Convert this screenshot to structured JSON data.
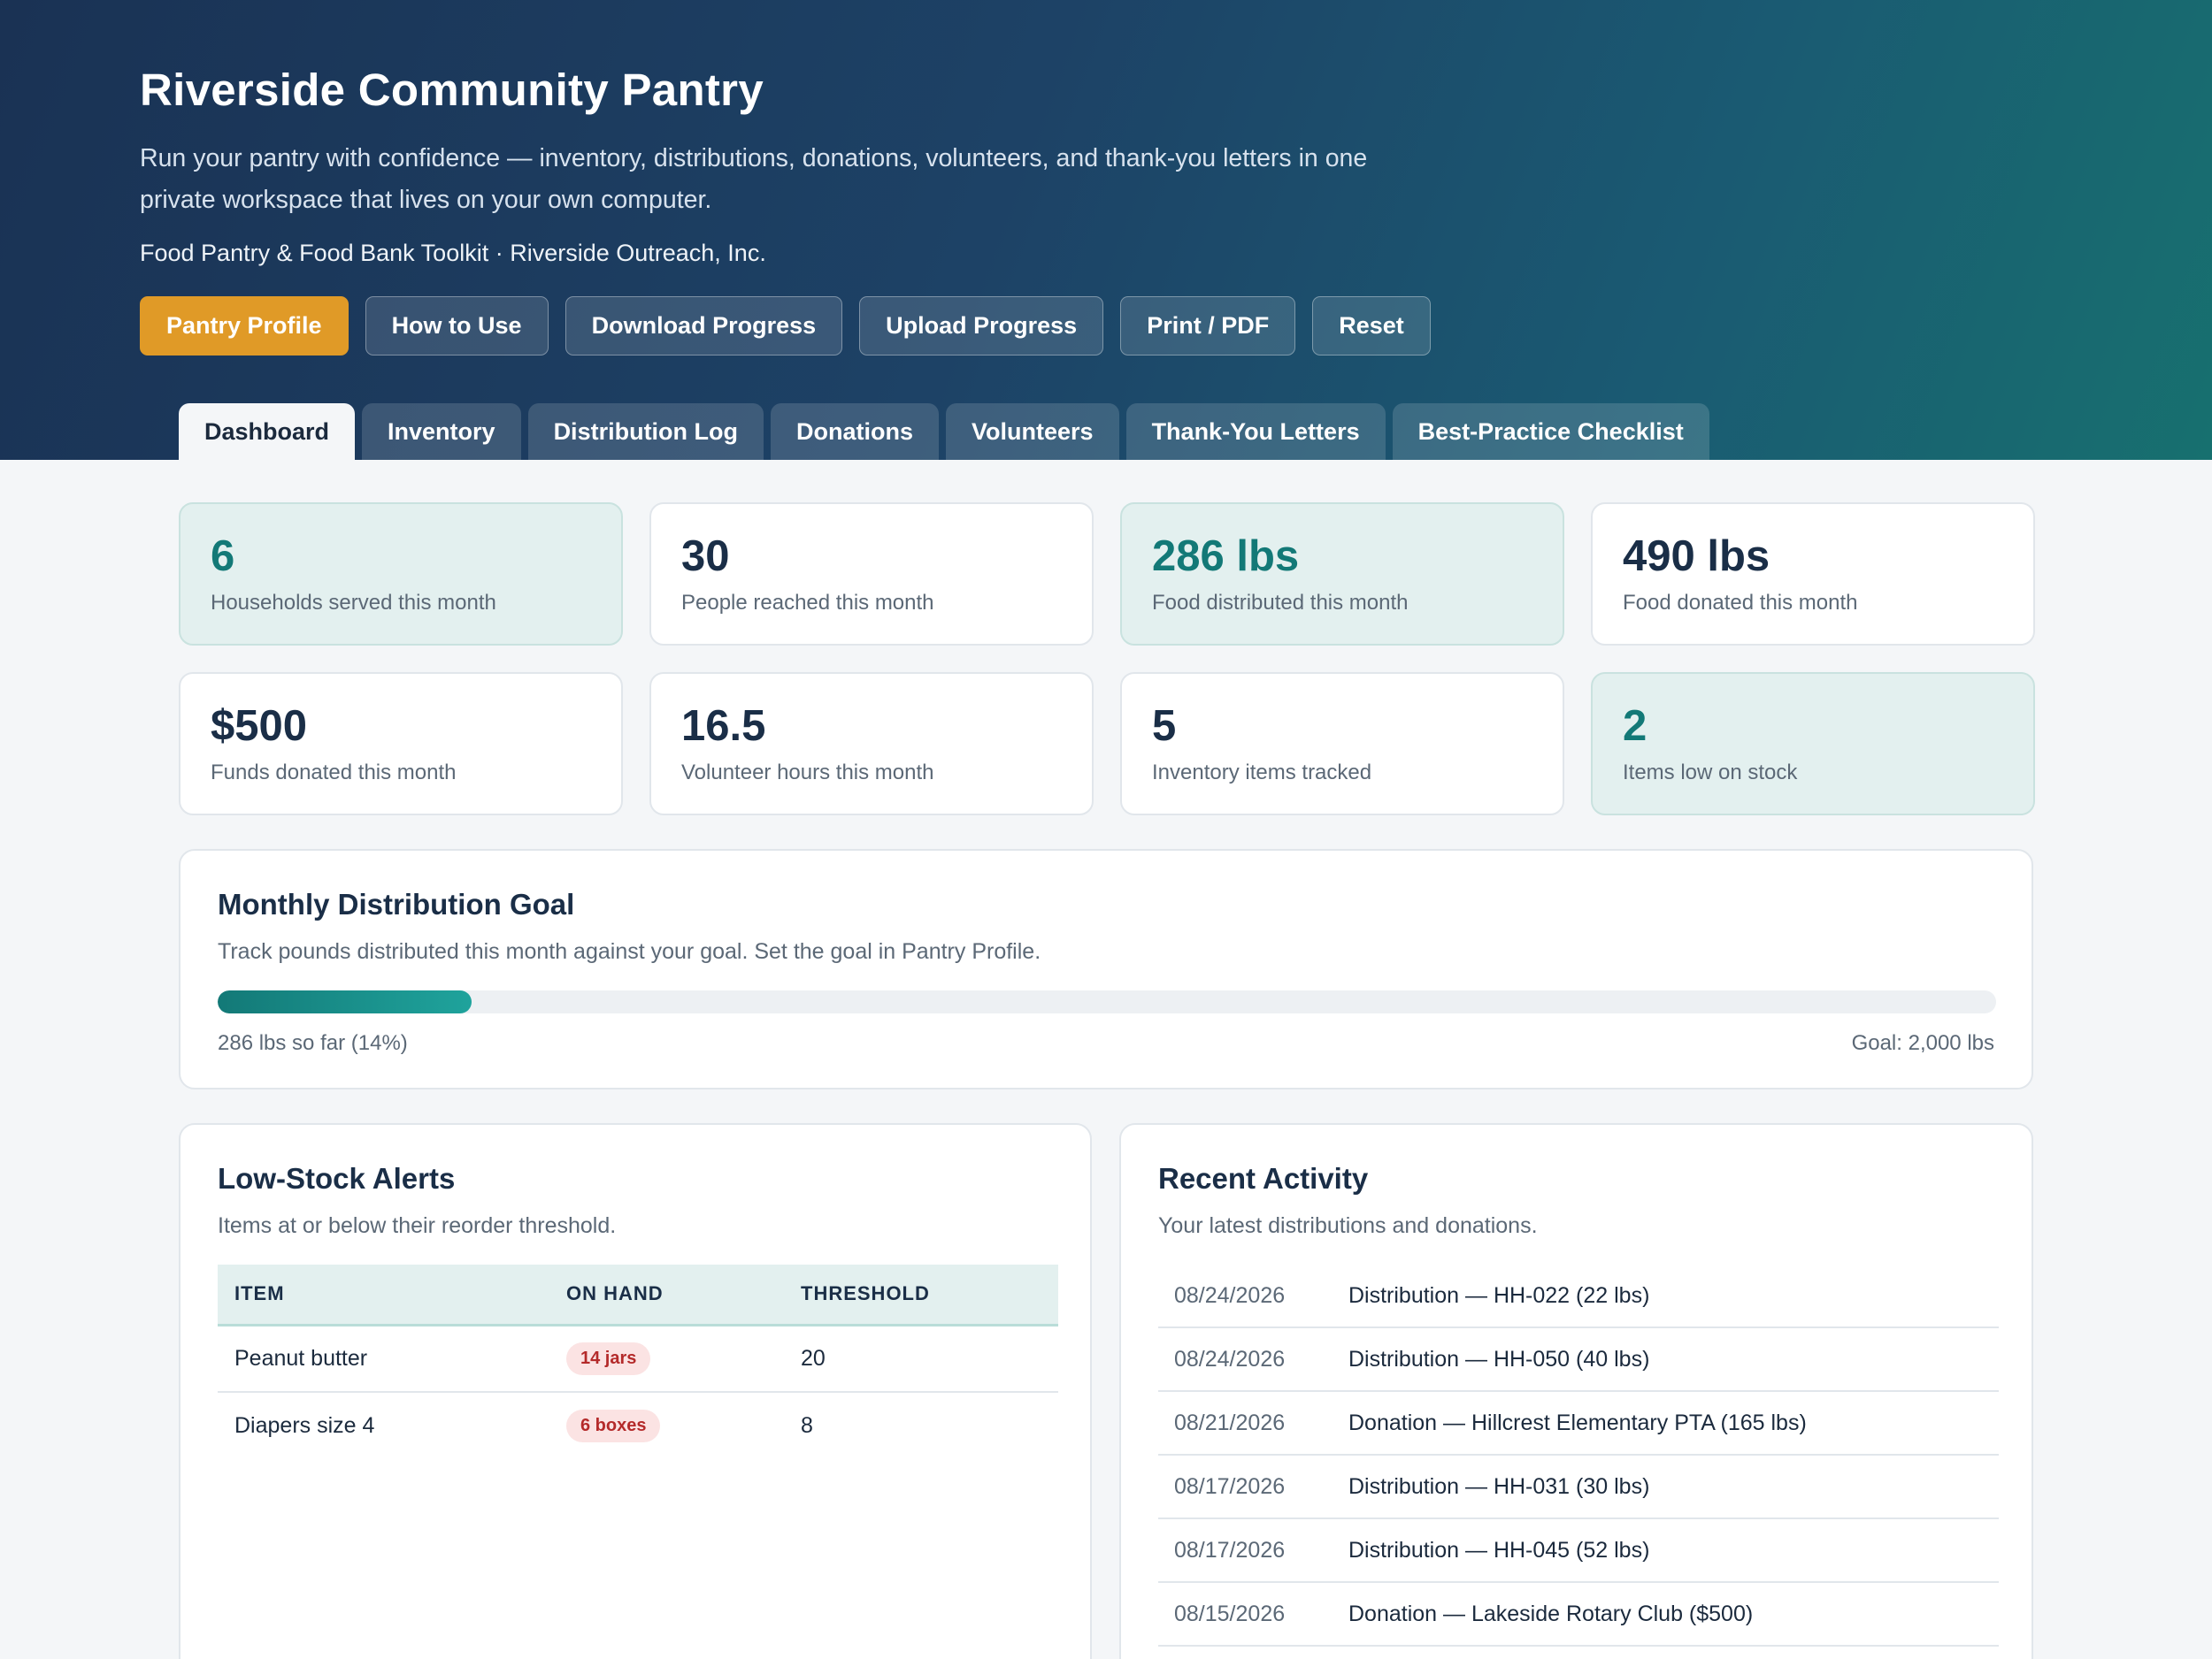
{
  "header": {
    "title": "Riverside Community Pantry",
    "description": "Run your pantry with confidence — inventory, distributions, donations, volunteers, and thank-you letters in one private workspace that lives on your own computer.",
    "org_line": "Food Pantry & Food Bank Toolkit · Riverside Outreach, Inc."
  },
  "toolbar": {
    "buttons": [
      {
        "label": "Pantry Profile"
      },
      {
        "label": "How to Use"
      },
      {
        "label": "Download Progress"
      },
      {
        "label": "Upload Progress"
      },
      {
        "label": "Print / PDF"
      },
      {
        "label": "Reset"
      }
    ]
  },
  "tabs": [
    {
      "label": "Dashboard",
      "active": true
    },
    {
      "label": "Inventory"
    },
    {
      "label": "Distribution Log"
    },
    {
      "label": "Donations"
    },
    {
      "label": "Volunteers"
    },
    {
      "label": "Thank-You Letters"
    },
    {
      "label": "Best-Practice Checklist"
    }
  ],
  "stats": [
    {
      "value": "6",
      "label": "Households served this month"
    },
    {
      "value": "30",
      "label": "People reached this month"
    },
    {
      "value": "286 lbs",
      "label": "Food distributed this month"
    },
    {
      "value": "490 lbs",
      "label": "Food donated this month"
    },
    {
      "value": "$500",
      "label": "Funds donated this month"
    },
    {
      "value": "16.5",
      "label": "Volunteer hours this month"
    },
    {
      "value": "5",
      "label": "Inventory items tracked"
    },
    {
      "value": "2",
      "label": "Items low on stock"
    }
  ],
  "goal": {
    "title": "Monthly Distribution Goal",
    "subtitle": "Track pounds distributed this month against your goal. Set the goal in Pantry Profile.",
    "progress_fraction": 0.143,
    "so_far_text": "286 lbs so far (14%)",
    "target_text": "Goal: 2,000 lbs"
  },
  "low_stock": {
    "title": "Low-Stock Alerts",
    "subtitle": "Items at or below their reorder threshold.",
    "columns": [
      "ITEM",
      "ON HAND",
      "THRESHOLD"
    ],
    "rows": [
      {
        "item": "Peanut butter",
        "on_hand": "14 jars",
        "threshold": "20"
      },
      {
        "item": "Diapers size 4",
        "on_hand": "6 boxes",
        "threshold": "8"
      }
    ]
  },
  "activity": {
    "title": "Recent Activity",
    "subtitle": "Your latest distributions and donations.",
    "rows": [
      {
        "date": "08/24/2026",
        "text": "Distribution — HH-022 (22 lbs)"
      },
      {
        "date": "08/24/2026",
        "text": "Distribution — HH-050 (40 lbs)"
      },
      {
        "date": "08/21/2026",
        "text": "Donation — Hillcrest Elementary PTA (165 lbs)"
      },
      {
        "date": "08/17/2026",
        "text": "Distribution — HH-031 (30 lbs)"
      },
      {
        "date": "08/17/2026",
        "text": "Distribution — HH-045 (52 lbs)"
      },
      {
        "date": "08/15/2026",
        "text": "Donation — Lakeside Rotary Club ($500)"
      }
    ]
  },
  "colors": {
    "primary_button": "#e09a27",
    "accent_teal": "#137977",
    "alert_red": "#b42a2a",
    "header_navy": "#1a3254"
  }
}
